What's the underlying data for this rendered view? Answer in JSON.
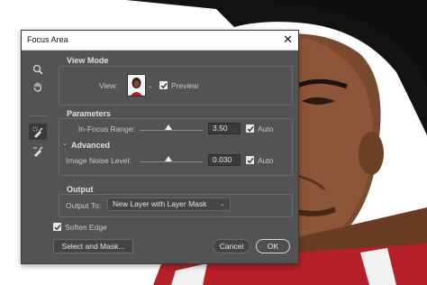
{
  "dialog": {
    "title": "Focus Area",
    "close_glyph": "✕"
  },
  "tools": [
    "zoom-icon",
    "hand-icon",
    "focus-area-add-brush-icon",
    "focus-area-subtract-brush-icon"
  ],
  "view_mode": {
    "heading": "View Mode",
    "view_label": "View:",
    "preview_label": "Preview",
    "preview_checked": true
  },
  "parameters": {
    "heading": "Parameters",
    "in_focus_range_label": "In-Focus Range:",
    "in_focus_range_value": "3.50",
    "in_focus_range_auto_label": "Auto",
    "in_focus_range_auto_checked": true,
    "in_focus_range_slider": 0.45,
    "advanced_label": "Advanced",
    "noise_label": "Image Noise Level:",
    "noise_value": "0.030",
    "noise_auto_label": "Auto",
    "noise_auto_checked": true,
    "noise_slider": 0.45
  },
  "output": {
    "heading": "Output",
    "output_to_label": "Output To:",
    "output_to_value": "New Layer with Layer Mask"
  },
  "soften_edge": {
    "label": "Soften Edge",
    "checked": true
  },
  "buttons": {
    "select_and_mask": "Select and Mask...",
    "cancel": "Cancel",
    "ok": "OK"
  },
  "colors": {
    "dialog_bg": "#535353",
    "title_bg": "#ffffff",
    "text": "#c8c8c8"
  }
}
